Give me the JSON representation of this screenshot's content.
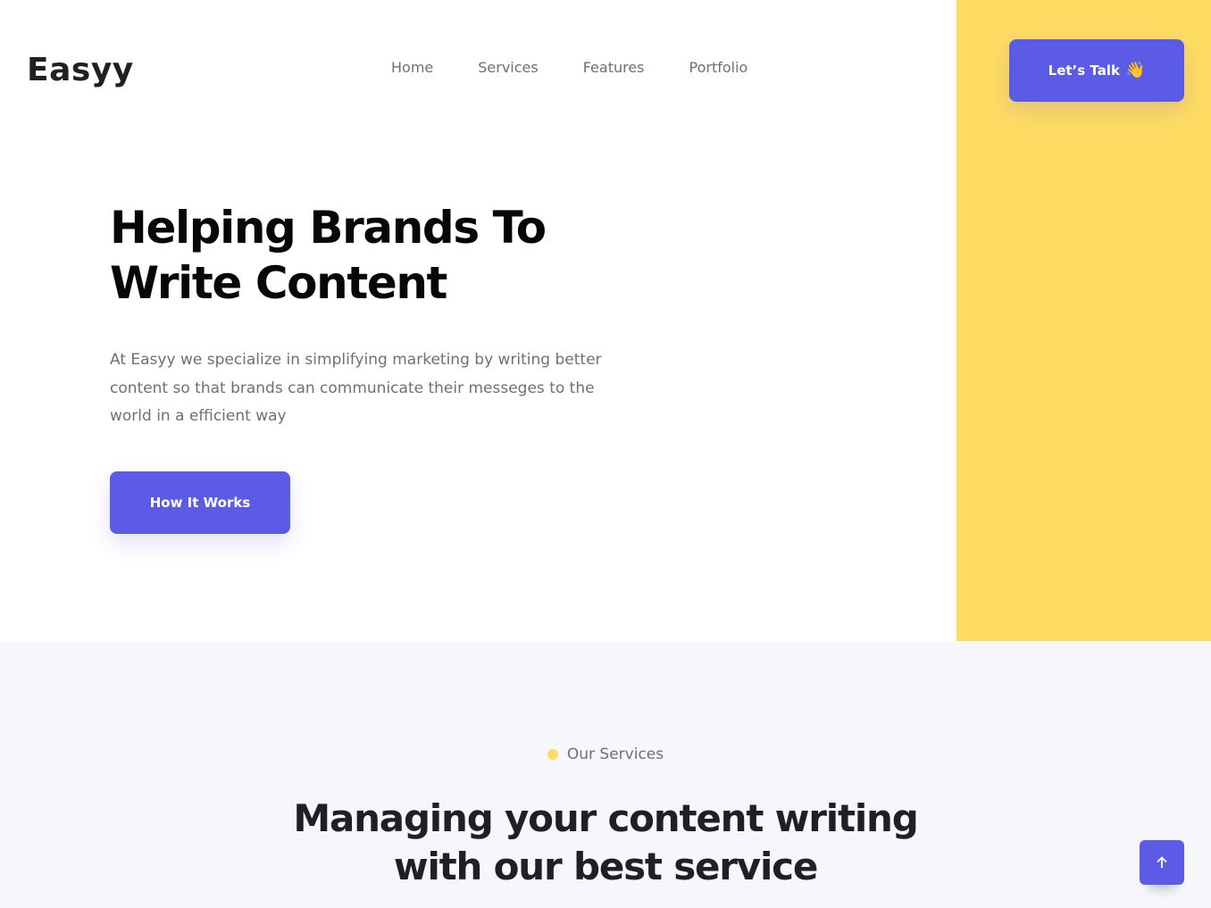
{
  "header": {
    "logo": "Easyy",
    "nav": [
      "Home",
      "Services",
      "Features",
      "Portfolio"
    ],
    "cta_label": "Let’s Talk",
    "cta_icon": "waving-hand-icon"
  },
  "hero": {
    "title_line1": "Helping Brands To",
    "title_line2": "Write Content",
    "description": "At Easyy we specialize in simplifying marketing by writing better content so that brands can communicate their messeges to the world in a efficient way",
    "button_label": "How It Works"
  },
  "services": {
    "kicker": "Our Services",
    "title_line1": "Managing your content writing",
    "title_line2_prefix": "with our",
    "title_line2_highlight": "best service"
  },
  "scroll_top": {
    "icon": "arrow-up-icon"
  },
  "colors": {
    "accent": "#5b5be6",
    "yellow": "#fedc62",
    "section_bg": "#f6f7fb"
  }
}
